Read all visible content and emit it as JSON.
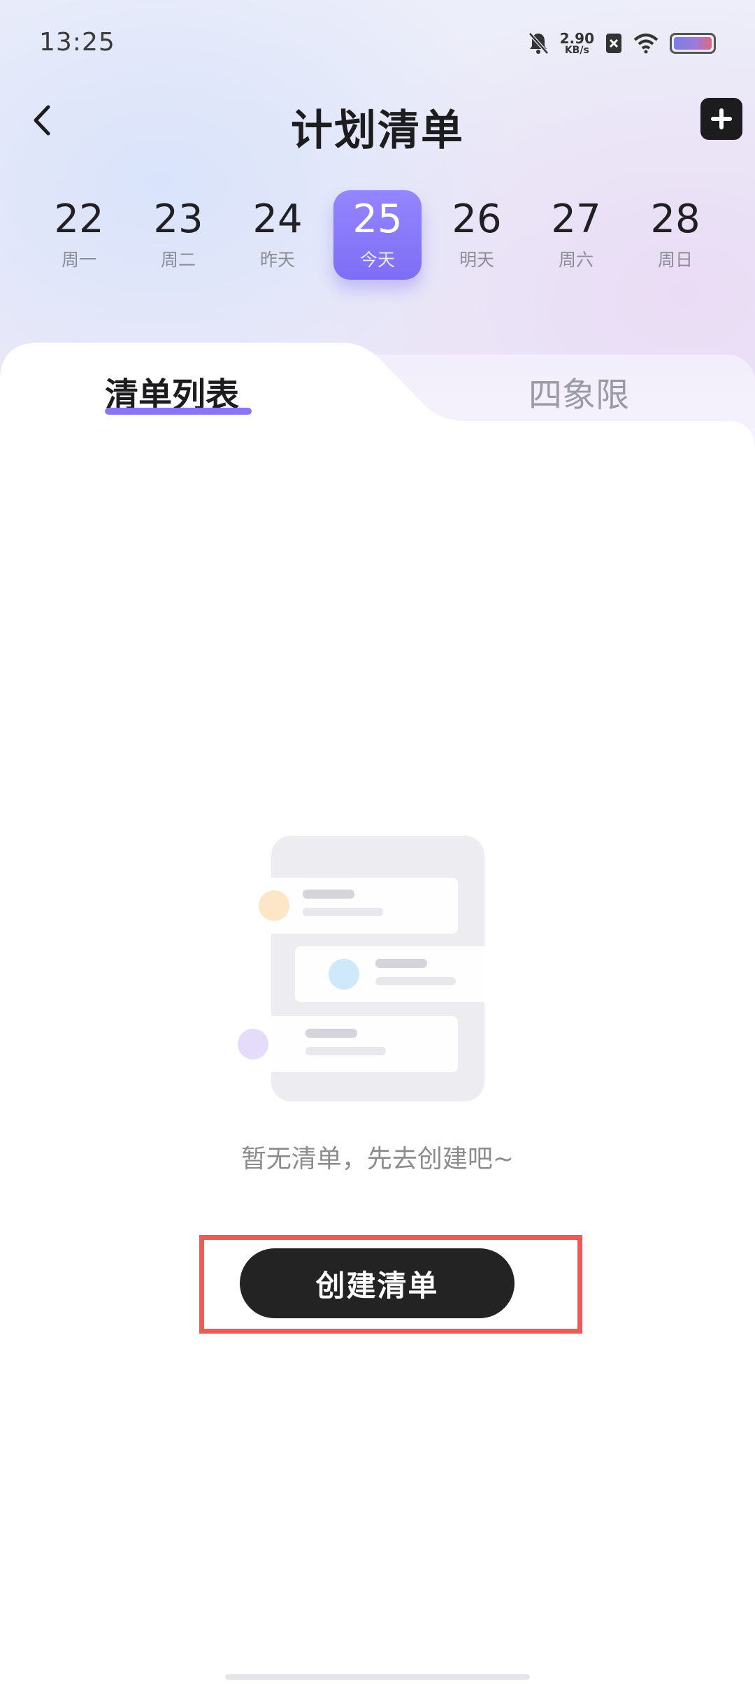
{
  "status_bar": {
    "time": "13:25",
    "net_speed_value": "2.90",
    "net_speed_unit": "KB/s",
    "icons": [
      "mute-icon",
      "sim-error-icon",
      "wifi-icon",
      "battery-icon"
    ]
  },
  "header": {
    "title": "计划清单",
    "back_icon": "chevron-left-icon",
    "add_icon": "plus-icon"
  },
  "dates": [
    {
      "day": "22",
      "label": "周一",
      "active": false
    },
    {
      "day": "23",
      "label": "周二",
      "active": false
    },
    {
      "day": "24",
      "label": "昨天",
      "active": false
    },
    {
      "day": "25",
      "label": "今天",
      "active": true
    },
    {
      "day": "26",
      "label": "明天",
      "active": false
    },
    {
      "day": "27",
      "label": "周六",
      "active": false
    },
    {
      "day": "28",
      "label": "周日",
      "active": false
    }
  ],
  "tabs": [
    {
      "label": "清单列表",
      "active": true
    },
    {
      "label": "四象限",
      "active": false
    }
  ],
  "empty_state": {
    "message": "暂无清单，先去创建吧~",
    "button_label": "创建清单"
  },
  "colors": {
    "accent": "#8a76f2",
    "active_date": "#8a7cf8",
    "button_bg": "#232323",
    "highlight": "#ec5b57"
  }
}
